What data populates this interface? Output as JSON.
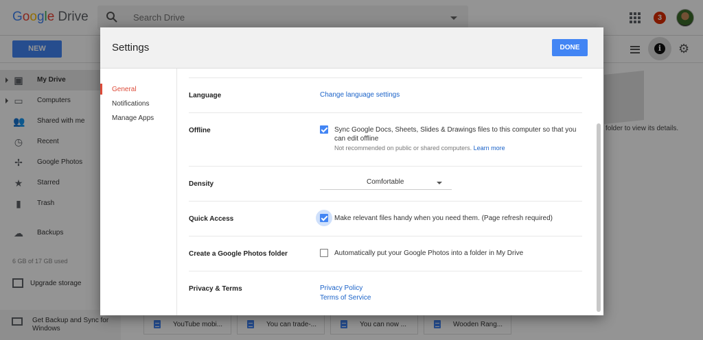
{
  "app": {
    "logo_google": [
      "G",
      "o",
      "o",
      "g",
      "l",
      "e"
    ],
    "logo_drive": "Drive",
    "search_placeholder": "Search Drive",
    "notification_count": "3",
    "new_button": "NEW",
    "info_glyph": "i"
  },
  "sidebar": {
    "items": [
      {
        "label": "My Drive",
        "icon": "drive-icon"
      },
      {
        "label": "Computers",
        "icon": "computer-icon"
      },
      {
        "label": "Shared with me",
        "icon": "people-icon"
      },
      {
        "label": "Recent",
        "icon": "clock-icon"
      },
      {
        "label": "Google Photos",
        "icon": "pinwheel-icon"
      },
      {
        "label": "Starred",
        "icon": "star-icon"
      },
      {
        "label": "Trash",
        "icon": "trash-icon"
      },
      {
        "label": "Backups",
        "icon": "cloud-icon"
      }
    ],
    "storage": "6 GB of 17 GB used",
    "upgrade": "Upgrade storage",
    "backup_sync": "Get Backup and Sync for Windows"
  },
  "details": {
    "text": "folder to view its details."
  },
  "recent_files": [
    "YouTube mobi...",
    "You can trade-...",
    "You can now ...",
    "Wooden Rang..."
  ],
  "dialog": {
    "title": "Settings",
    "done_label": "DONE",
    "nav": [
      {
        "label": "General",
        "active": true
      },
      {
        "label": "Notifications",
        "active": false
      },
      {
        "label": "Manage Apps",
        "active": false
      }
    ],
    "language": {
      "label": "Language",
      "link": "Change language settings"
    },
    "offline": {
      "label": "Offline",
      "checked": true,
      "text": "Sync Google Docs, Sheets, Slides & Drawings files to this computer so that you can edit offline",
      "note": "Not recommended on public or shared computers.",
      "note_link": "Learn more"
    },
    "density": {
      "label": "Density",
      "value": "Comfortable"
    },
    "quick_access": {
      "label": "Quick Access",
      "checked": true,
      "text": "Make relevant files handy when you need them. (Page refresh required)"
    },
    "photos_folder": {
      "label": "Create a Google Photos folder",
      "checked": false,
      "text": "Automatically put your Google Photos into a folder in My Drive"
    },
    "privacy": {
      "label": "Privacy & Terms",
      "links": [
        "Privacy Policy",
        "Terms of Service"
      ]
    }
  },
  "colors": {
    "accent_blue": "#4285f4",
    "link_blue": "#1a62c8",
    "active_red": "#dd4b39"
  }
}
